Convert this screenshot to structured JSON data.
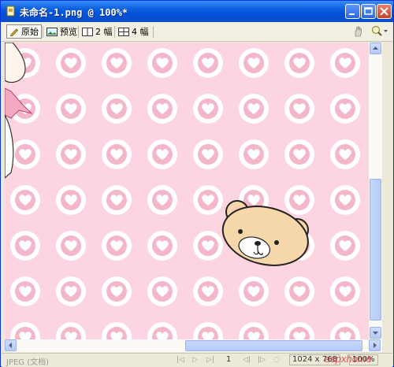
{
  "window": {
    "title": "未命名-1.png @ 100%*"
  },
  "toolbar": {
    "items": [
      {
        "label": "原始",
        "icon": "pencil-icon"
      },
      {
        "label": "预览",
        "icon": "image-icon"
      },
      {
        "label": "2 幅",
        "icon": "two-panel-icon"
      },
      {
        "label": "4 幅",
        "icon": "four-panel-icon"
      }
    ],
    "right_icons": [
      "hand-tool-icon",
      "zoom-tool-icon"
    ]
  },
  "canvas": {
    "background": "#fcd5e0",
    "pattern_color": "#ffffff",
    "heart_color": "#f4b7c8"
  },
  "statusbar": {
    "format": "JPEG (文档)",
    "page": "1",
    "dimensions": "1024 x 768",
    "zoom": "100%"
  },
  "watermark": "aspxhome"
}
